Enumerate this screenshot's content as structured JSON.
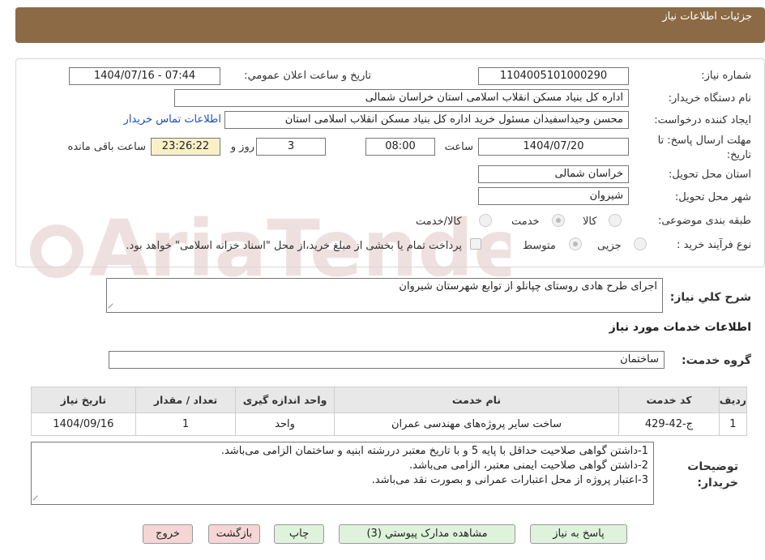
{
  "header": {
    "title": "جزئیات اطلاعات نیاز"
  },
  "need_number": {
    "label": "شماره نیاز:",
    "value": "1104005101000290"
  },
  "announce_datetime": {
    "label": "تاریخ و ساعت اعلان عمومي:",
    "value": "1404/07/16 - 07:44"
  },
  "buyer_org": {
    "label": "نام دستگاه خریدار:",
    "value": "اداره کل بنیاد مسکن انقلاب اسلامی استان خراسان شمالی"
  },
  "requester": {
    "label": "ایجاد کننده درخواست:",
    "value": "محسن وحیداسفیدان مسئول خرید اداره کل بنیاد مسکن انقلاب اسلامی استان",
    "contact_link": "اطلاعات تماس خریدار"
  },
  "deadline": {
    "label": "مهلت ارسال پاسخ: تا تاریخ:",
    "date": "1404/07/20",
    "time_label": "ساعت",
    "time": "08:00",
    "days": "3",
    "days_label": "روز و",
    "remaining": "23:26:22",
    "remaining_label": "ساعت باقی مانده"
  },
  "delivery_province": {
    "label": "استان محل تحویل:",
    "value": "خراسان شمالی"
  },
  "delivery_city": {
    "label": "شهر محل تحویل:",
    "value": "شیروان"
  },
  "subject_category": {
    "label": "طبقه بندی موضوعی:",
    "options": [
      "کالا",
      "خدمت",
      "کالا/خدمت"
    ],
    "selected": "خدمت"
  },
  "purchase_process": {
    "label": "نوع فرآیند خرید :",
    "options": [
      "جزیی",
      "متوسط"
    ],
    "selected": "متوسط",
    "payment_note": "پرداخت تمام یا بخشی از مبلغ خرید،از محل \"اسناد خزانه اسلامی\" خواهد بود."
  },
  "general_description": {
    "label": "شرح کلي نیاز:",
    "value": "اجرای طرح هادی روستای چپانلو از توابع شهرستان شیروان"
  },
  "services_section": {
    "title": "اطلاعات خدمات مورد نیاز"
  },
  "service_group": {
    "label": "گروه خدمت:",
    "value": "ساختمان"
  },
  "services_table": {
    "headers": [
      "ردیف",
      "کد خدمت",
      "نام خدمت",
      "واحد اندازه گیری",
      "تعداد / مقدار",
      "تاریخ نیاز"
    ],
    "rows": [
      [
        "1",
        "ج-42-429",
        "ساخت سایر پروژه‌های مهندسی عمران",
        "واحد",
        "1",
        "1404/09/16"
      ]
    ]
  },
  "buyer_notes": {
    "label": "توضیحات خریدار:",
    "lines": [
      "1-داشتن گواهی صلاحیت حداقل با پایه 5 و با تاریخ معتبر دررشته ابنیه و ساختمان الزامی می‌باشد.",
      "2-داشتن گواهی صلاحیت ایمنی معتبر، الزامی می‌باشد.",
      "3-اعتبار پروژه از محل اعتبارات عمرانی و بصورت نقد می‌باشد."
    ]
  },
  "buttons": {
    "reply": "پاسخ به نیاز",
    "attachments": "مشاهده مدارک پیوستي (3)",
    "print": "چاپ",
    "back": "بازگشت",
    "exit": "خروج"
  },
  "watermark_text": "AriaTender.neT",
  "colors": {
    "header_bg": "#8b6a45",
    "timer_bg": "#f8f1c8",
    "button_green": "#dff2dc",
    "button_pink": "#f6d5d5",
    "link": "#1a4fb5"
  }
}
